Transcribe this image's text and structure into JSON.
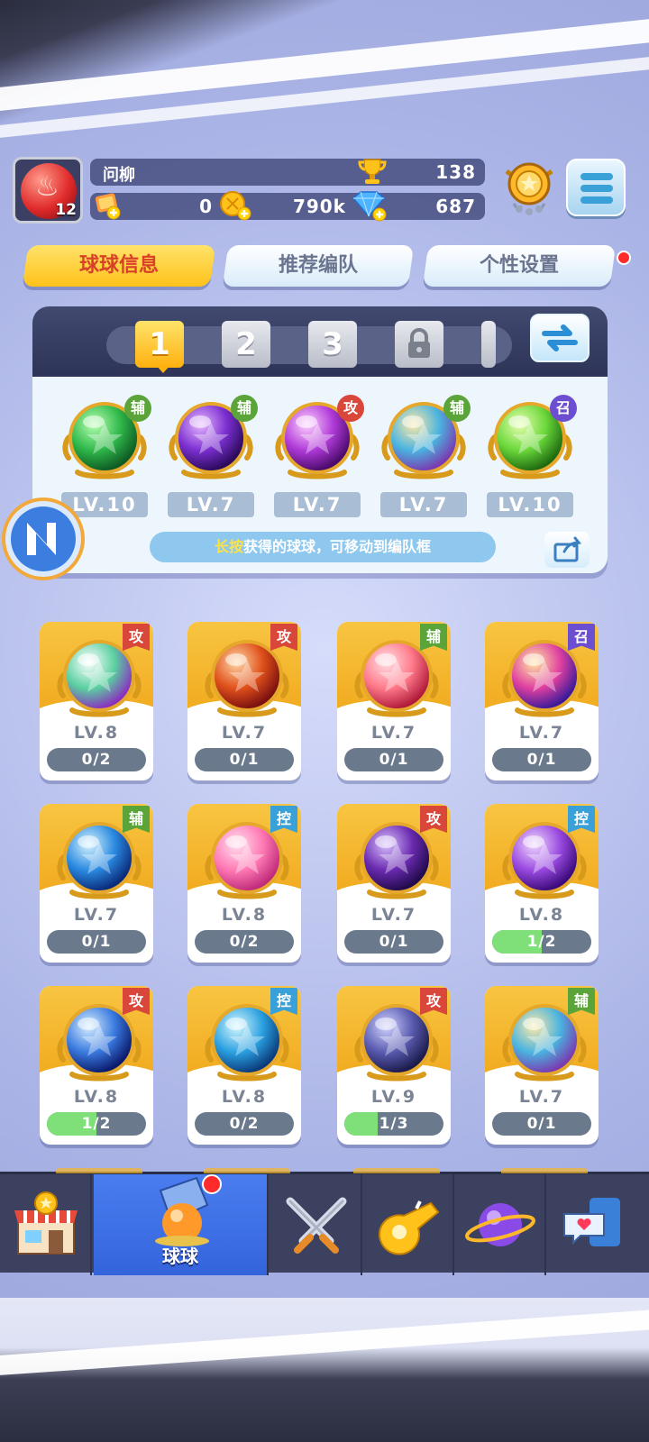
{
  "player": {
    "name": "问柳",
    "level": "12",
    "trophies": "138"
  },
  "resources": {
    "tickets": "0",
    "coins": "790k",
    "gems": "687"
  },
  "tabs": [
    {
      "label": "球球信息",
      "active": true
    },
    {
      "label": "推荐编队",
      "active": false
    },
    {
      "label": "个性设置",
      "active": false
    }
  ],
  "team_slots": [
    "1",
    "2",
    "3"
  ],
  "team": [
    {
      "level": "LV.10",
      "tag": "辅",
      "icon": "green-arrow-orb"
    },
    {
      "level": "LV.7",
      "tag": "辅",
      "icon": "purple-leaf-orb"
    },
    {
      "level": "LV.7",
      "tag": "攻",
      "icon": "fish-orb"
    },
    {
      "level": "LV.7",
      "tag": "辅",
      "icon": "figures-orb"
    },
    {
      "level": "LV.10",
      "tag": "召",
      "icon": "green-star-orb"
    }
  ],
  "hint": {
    "highlight": "长按",
    "text": "获得的球球，可移动到编队框"
  },
  "collection": [
    {
      "level": "LV.8",
      "progress": "0/2",
      "fraction": 0,
      "tag": "攻",
      "icon": "prism-orb"
    },
    {
      "level": "LV.7",
      "progress": "0/1",
      "fraction": 0,
      "tag": "攻",
      "icon": "dragon-orb"
    },
    {
      "level": "LV.7",
      "progress": "0/1",
      "fraction": 0,
      "tag": "辅",
      "icon": "gift-orb"
    },
    {
      "level": "LV.7",
      "progress": "0/1",
      "fraction": 0,
      "tag": "召",
      "icon": "phoenix-orb"
    },
    {
      "level": "LV.7",
      "progress": "0/1",
      "fraction": 0,
      "tag": "辅",
      "icon": "ice-crystal-orb"
    },
    {
      "level": "LV.8",
      "progress": "0/2",
      "fraction": 0,
      "tag": "控",
      "icon": "heart-orb"
    },
    {
      "level": "LV.7",
      "progress": "0/1",
      "fraction": 0,
      "tag": "攻",
      "icon": "sword-orb"
    },
    {
      "level": "LV.8",
      "progress": "1/2",
      "fraction": 0.5,
      "tag": "控",
      "icon": "butterfly-orb"
    },
    {
      "level": "LV.8",
      "progress": "1/2",
      "fraction": 0.5,
      "tag": "攻",
      "icon": "swirl-orb"
    },
    {
      "level": "LV.8",
      "progress": "0/2",
      "fraction": 0,
      "tag": "控",
      "icon": "cloud-orb"
    },
    {
      "level": "LV.9",
      "progress": "1/3",
      "fraction": 0.333,
      "tag": "攻",
      "icon": "pixel-orb"
    },
    {
      "level": "LV.7",
      "progress": "0/1",
      "fraction": 0,
      "tag": "辅",
      "icon": "figures-orb"
    }
  ],
  "nav": {
    "selected_label": "球球",
    "items": [
      "shop-icon",
      "ball-icon",
      "battle-icon",
      "whistle-icon",
      "planet-icon",
      "chat-icon"
    ]
  },
  "colors": {
    "attack": "#d9463a",
    "support": "#5aa43a",
    "control": "#3aa0d8",
    "summon": "#6b4fd0",
    "accent": "#ffc21a",
    "nav_selected": "#3f72e6"
  }
}
